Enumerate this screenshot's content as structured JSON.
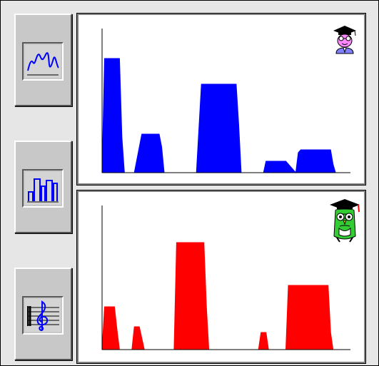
{
  "toolbar": {
    "buttons": [
      {
        "name": "line-view-button",
        "icon": "waveform-icon"
      },
      {
        "name": "bar-view-button",
        "icon": "bar-chart-icon"
      },
      {
        "name": "music-view-button",
        "icon": "treble-clef-icon"
      }
    ]
  },
  "panels": {
    "top": {
      "avatar": "graduate-person-icon",
      "color": "#0000ff"
    },
    "bottom": {
      "avatar": "graduate-owl-icon",
      "color": "#ff0000"
    }
  },
  "chart_data": [
    {
      "type": "area",
      "title": "",
      "xlabel": "",
      "ylabel": "",
      "grid": false,
      "xlim": [
        0,
        100
      ],
      "ylim": [
        0,
        100
      ],
      "series": [
        {
          "color": "#0000ff",
          "x": [
            0,
            1,
            2,
            7,
            8,
            9,
            13,
            16,
            17,
            23,
            24,
            25,
            38,
            40,
            41,
            54,
            55,
            56,
            65,
            66,
            67,
            71,
            74,
            78,
            79,
            80,
            92,
            93,
            94,
            100
          ],
          "y": [
            0,
            80,
            80,
            80,
            25,
            0,
            0,
            27,
            27,
            27,
            18,
            0,
            0,
            62,
            62,
            62,
            34,
            0,
            0,
            8,
            8,
            8,
            8,
            0,
            14,
            16,
            16,
            6,
            0,
            0
          ]
        }
      ]
    },
    {
      "type": "area",
      "title": "",
      "xlabel": "",
      "ylabel": "",
      "grid": false,
      "xlim": [
        0,
        100
      ],
      "ylim": [
        0,
        100
      ],
      "series": [
        {
          "color": "#ff0000",
          "x": [
            0,
            1,
            2,
            5,
            6,
            7,
            12,
            13,
            15,
            16,
            17,
            29,
            30,
            31,
            41,
            42,
            43,
            63,
            64,
            66,
            67,
            68,
            74,
            75,
            76,
            91,
            92,
            93,
            100
          ],
          "y": [
            0,
            30,
            30,
            30,
            14,
            0,
            0,
            16,
            16,
            8,
            0,
            0,
            75,
            75,
            75,
            30,
            0,
            0,
            12,
            12,
            0,
            0,
            0,
            45,
            45,
            45,
            12,
            0,
            0
          ]
        }
      ]
    }
  ]
}
